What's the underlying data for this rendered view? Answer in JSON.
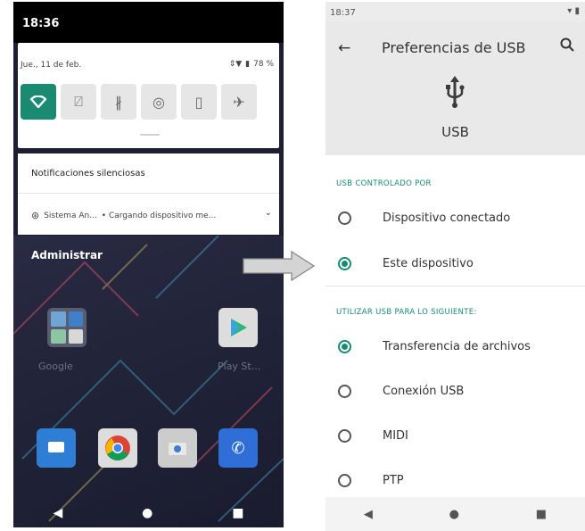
{
  "left": {
    "time": "18:36",
    "date": "Jue., 11 de feb.",
    "battery": "78 %",
    "tiles": [
      {
        "icon": "wifi-icon",
        "active": true
      },
      {
        "icon": "rotate-icon",
        "active": false
      },
      {
        "icon": "bluetooth-icon",
        "active": false
      },
      {
        "icon": "hotspot-icon",
        "active": false
      },
      {
        "icon": "flashlight-icon",
        "active": false
      },
      {
        "icon": "airplane-icon",
        "active": false
      }
    ],
    "notif_header": "Notificaciones silenciosas",
    "notif_app": "Sistema An...",
    "notif_text": "• Cargando dispositivo me...",
    "admin": "Administrar",
    "app_google": "Google",
    "app_play": "Play St..."
  },
  "right": {
    "time": "18:37",
    "title": "Preferencias de USB",
    "usb_label": "USB",
    "section1": "USB CONTROLADO POR",
    "section1_options": [
      {
        "label": "Dispositivo conectado",
        "selected": false
      },
      {
        "label": "Este dispositivo",
        "selected": true
      }
    ],
    "section2": "UTILIZAR USB PARA LO SIGUIENTE:",
    "section2_options": [
      {
        "label": "Transferencia de archivos",
        "selected": true
      },
      {
        "label": "Conexión USB",
        "selected": false
      },
      {
        "label": "MIDI",
        "selected": false
      },
      {
        "label": "PTP",
        "selected": false
      }
    ]
  },
  "colors": {
    "accent": "#1a8a72",
    "wallpaper": "#1d1e33"
  }
}
